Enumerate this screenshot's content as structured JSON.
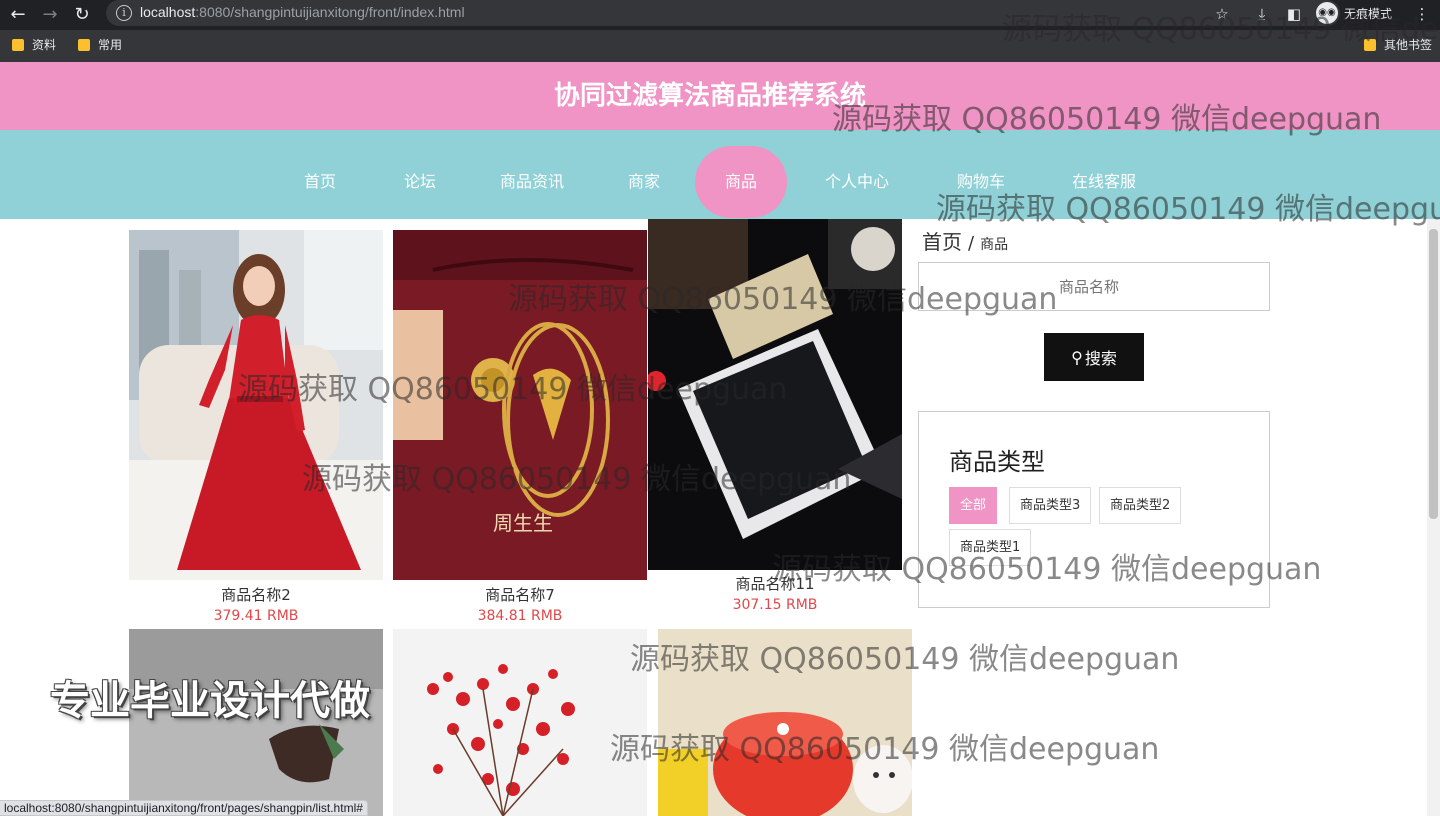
{
  "browser": {
    "url_host": "localhost",
    "url_rest": ":8080/shangpintuijianxitong/front/index.html",
    "incognito_label": "无痕模式",
    "bookmarks": [
      "资料",
      "常用"
    ],
    "other_bookmarks": "其他书签",
    "status_url": "localhost:8080/shangpintuijianxitong/front/pages/shangpin/list.html#"
  },
  "site": {
    "title": "协同过滤算法商品推荐系统"
  },
  "nav": {
    "items": [
      "首页",
      "论坛",
      "商品资讯",
      "商家",
      "商品",
      "个人中心",
      "购物车",
      "在线客服"
    ],
    "active": "商品"
  },
  "products": [
    {
      "name": "商品名称2",
      "price": "379.41 RMB"
    },
    {
      "name": "商品名称7",
      "price": "384.81 RMB"
    },
    {
      "name": "商品名称11",
      "price": "307.15 RMB"
    }
  ],
  "sidebar": {
    "breadcrumb_home": "首页",
    "breadcrumb_sep": "/",
    "breadcrumb_current": "商品",
    "search_placeholder": "商品名称",
    "search_button": "搜索",
    "type_title": "商品类型",
    "types": [
      "全部",
      "商品类型3",
      "商品类型2",
      "商品类型1"
    ]
  },
  "watermarks": {
    "contact": "源码获取 QQ86050149 微信deepguan",
    "ad": "专业毕业设计代做"
  },
  "colors": {
    "header_pink": "#ef94c5",
    "nav_teal": "#8fd1d6",
    "price_red": "#e0484b"
  }
}
